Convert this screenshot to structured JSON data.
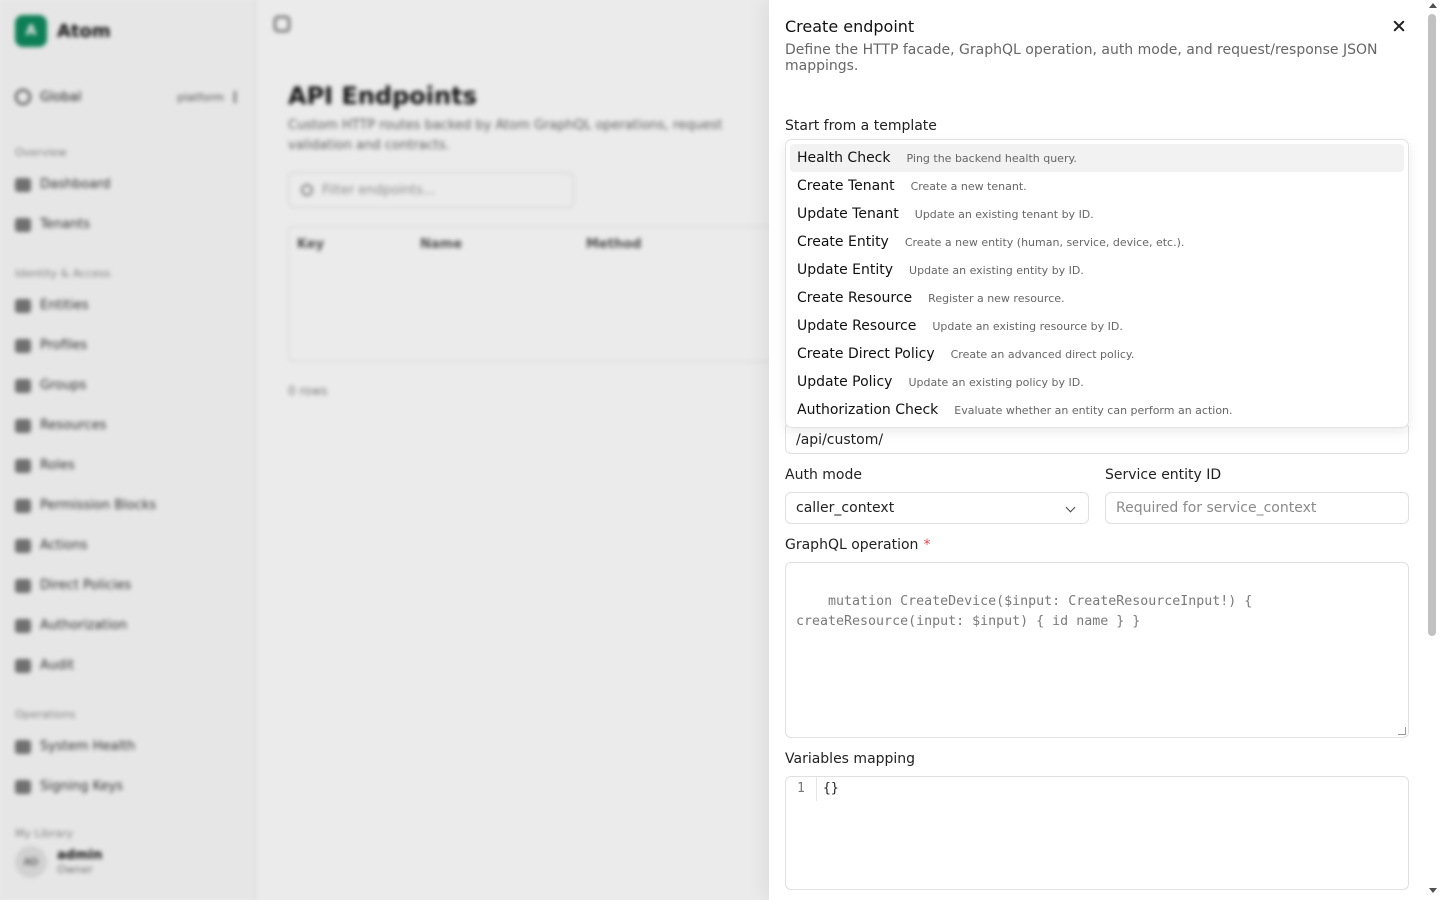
{
  "app": {
    "brand": {
      "logo_text": "A",
      "name": "Atom"
    },
    "scope": {
      "label": "Global",
      "tenant": "platform"
    },
    "nav": [
      {
        "section": "Overview",
        "items": [
          "Dashboard",
          "Tenants"
        ]
      },
      {
        "section": "Identity & Access",
        "items": [
          "Entities",
          "Profiles",
          "Groups",
          "Resources",
          "Roles",
          "Permission Blocks",
          "Actions",
          "Direct Policies",
          "Authorization",
          "Audit"
        ]
      },
      {
        "section": "Operations",
        "items": [
          "System Health",
          "Signing Keys"
        ]
      }
    ],
    "user_section": "My Library",
    "user": {
      "initials": "AD",
      "name": "admin",
      "role": "Owner"
    }
  },
  "page": {
    "title": "API Endpoints",
    "subtitle": "Custom HTTP routes backed by Atom GraphQL operations, request validation and contracts.",
    "filter_placeholder": "Filter endpoints...",
    "table_headers": [
      "Key",
      "Name",
      "Method"
    ],
    "row_count": "0 rows"
  },
  "sheet": {
    "title": "Create endpoint",
    "description": "Define the HTTP facade, GraphQL operation, auth mode, and request/response JSON mappings.",
    "template_label": "Start from a template",
    "templates": [
      {
        "title": "Health Check",
        "desc": "Ping the backend health query."
      },
      {
        "title": "Create Tenant",
        "desc": "Create a new tenant."
      },
      {
        "title": "Update Tenant",
        "desc": "Update an existing tenant by ID."
      },
      {
        "title": "Create Entity",
        "desc": "Create a new entity (human, service, device, etc.)."
      },
      {
        "title": "Update Entity",
        "desc": "Update an existing entity by ID."
      },
      {
        "title": "Create Resource",
        "desc": "Register a new resource."
      },
      {
        "title": "Update Resource",
        "desc": "Update an existing resource by ID."
      },
      {
        "title": "Create Direct Policy",
        "desc": "Create an advanced direct policy."
      },
      {
        "title": "Update Policy",
        "desc": "Update an existing policy by ID."
      },
      {
        "title": "Authorization Check",
        "desc": "Evaluate whether an entity can perform an action."
      }
    ],
    "path_value": "/api/custom/",
    "auth_mode_label": "Auth mode",
    "auth_mode_value": "caller_context",
    "service_entity_label": "Service entity ID",
    "service_entity_placeholder": "Required for service_context",
    "graphql_label": "GraphQL operation",
    "required_mark": "*",
    "graphql_placeholder": "mutation CreateDevice($input: CreateResourceInput!) {\ncreateResource(input: $input) { id name } }",
    "variables_label": "Variables mapping",
    "variables_line_number": "1",
    "variables_value": "{}"
  }
}
